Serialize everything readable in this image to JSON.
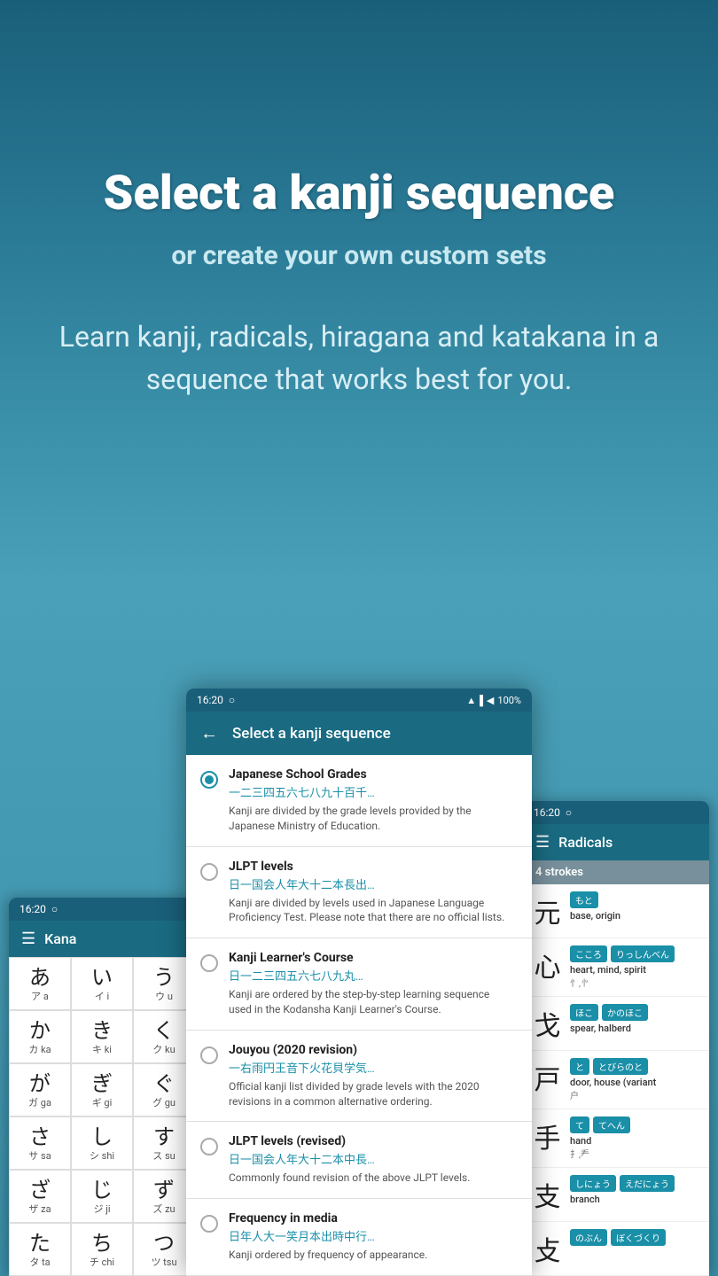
{
  "hero": {
    "title": "Select a kanji sequence",
    "subtitle": "or create your own custom sets",
    "description": "Learn kanji, radicals, hiragana and katakana in a sequence that works best for you."
  },
  "phones": {
    "center": {
      "status": {
        "time": "16:20",
        "wifi": "▲",
        "signal": "▌▌",
        "battery": "100%"
      },
      "appbar": {
        "back": "←",
        "title": "Select a kanji sequence"
      },
      "sequences": [
        {
          "id": "japanese-school-grades",
          "title": "Japanese School Grades",
          "kanji": "一二三四五六七八九十百千…",
          "desc": "Kanji are divided by the grade levels provided by the Japanese Ministry of Education.",
          "selected": true
        },
        {
          "id": "jlpt-levels",
          "title": "JLPT levels",
          "kanji": "日一国会人年大十二本長出…",
          "desc": "Kanji are divided by levels used in Japanese Language Proficiency Test. Please note that there are no official lists.",
          "selected": false
        },
        {
          "id": "kanji-learners-course",
          "title": "Kanji Learner's Course",
          "kanji": "日一二三四五六七八九丸…",
          "desc": "Kanji are ordered by the step-by-step learning sequence used in the Kodansha Kanji Learner's Course.",
          "selected": false
        },
        {
          "id": "jouyou",
          "title": "Jouyou (2020 revision)",
          "kanji": "一右雨円王音下火花貝学気…",
          "desc": "Official kanji list divided by grade levels with the 2020 revisions in a common alternative ordering.",
          "selected": false
        },
        {
          "id": "jlpt-revised",
          "title": "JLPT levels (revised)",
          "kanji": "日一国会人年大十二本中長…",
          "desc": "Commonly found revision of the above JLPT levels.",
          "selected": false
        },
        {
          "id": "frequency",
          "title": "Frequency in media",
          "kanji": "日年人大一笑月本出時中行…",
          "desc": "Kanji ordered by frequency of appearance.",
          "selected": false
        }
      ]
    },
    "left": {
      "status": {
        "time": "16:20"
      },
      "appbar": {
        "menu": "☰",
        "title": "Kana"
      },
      "kana": [
        {
          "hiragana": "あ",
          "katakana": "ア",
          "romaji": "a"
        },
        {
          "hiragana": "い",
          "katakana": "イ",
          "romaji": "i"
        },
        {
          "hiragana": "う",
          "katakana": "ウ",
          "romaji": "u"
        },
        {
          "hiragana": "か",
          "katakana": "カ",
          "romaji": "ka"
        },
        {
          "hiragana": "き",
          "katakana": "キ",
          "romaji": "ki"
        },
        {
          "hiragana": "く",
          "katakana": "ク",
          "romaji": "ku"
        },
        {
          "hiragana": "が",
          "katakana": "ガ",
          "romaji": "ga"
        },
        {
          "hiragana": "ぎ",
          "katakana": "ギ",
          "romaji": "gi"
        },
        {
          "hiragana": "ぐ",
          "katakana": "グ",
          "romaji": "gu"
        },
        {
          "hiragana": "さ",
          "katakana": "サ",
          "romaji": "sa"
        },
        {
          "hiragana": "し",
          "katakana": "シ",
          "romaji": "shi"
        },
        {
          "hiragana": "す",
          "katakana": "ス",
          "romaji": "su"
        },
        {
          "hiragana": "ざ",
          "katakana": "ザ",
          "romaji": "za"
        },
        {
          "hiragana": "じ",
          "katakana": "ジ",
          "romaji": "ji"
        },
        {
          "hiragana": "ず",
          "katakana": "ズ",
          "romaji": "zu"
        },
        {
          "hiragana": "た",
          "katakana": "タ",
          "romaji": "ta"
        },
        {
          "hiragana": "ち",
          "katakana": "チ",
          "romaji": "chi"
        },
        {
          "hiragana": "つ",
          "katakana": "ツ",
          "romaji": "tsu"
        }
      ]
    },
    "right": {
      "status": {
        "time": "16:20"
      },
      "appbar": {
        "menu": "☰",
        "title": "Radicals"
      },
      "strokes_header": "4 strokes",
      "radicals": [
        {
          "char": "元",
          "tags": [
            "もと"
          ],
          "meaning": "base, origin",
          "alt": ""
        },
        {
          "char": "心",
          "tags": [
            "こころ",
            "りっしんべん"
          ],
          "meaning": "heart, mind, spirit",
          "alt": "忄,㣺"
        },
        {
          "char": "戈",
          "tags": [
            "ほこ",
            "かのほこ"
          ],
          "meaning": "spear, halberd",
          "alt": ""
        },
        {
          "char": "戸",
          "tags": [
            "と",
            "とびらのと"
          ],
          "meaning": "door, house (variant",
          "alt": "户"
        },
        {
          "char": "手",
          "tags": [
            "て",
            "てへん"
          ],
          "meaning": "hand",
          "alt": "扌,龵"
        },
        {
          "char": "支",
          "tags": [
            "しにょう",
            "えだにょう"
          ],
          "meaning": "branch",
          "alt": ""
        },
        {
          "char": "攴",
          "tags": [
            "のぶん",
            "ぼくづくり"
          ],
          "meaning": "",
          "alt": ""
        }
      ]
    }
  }
}
